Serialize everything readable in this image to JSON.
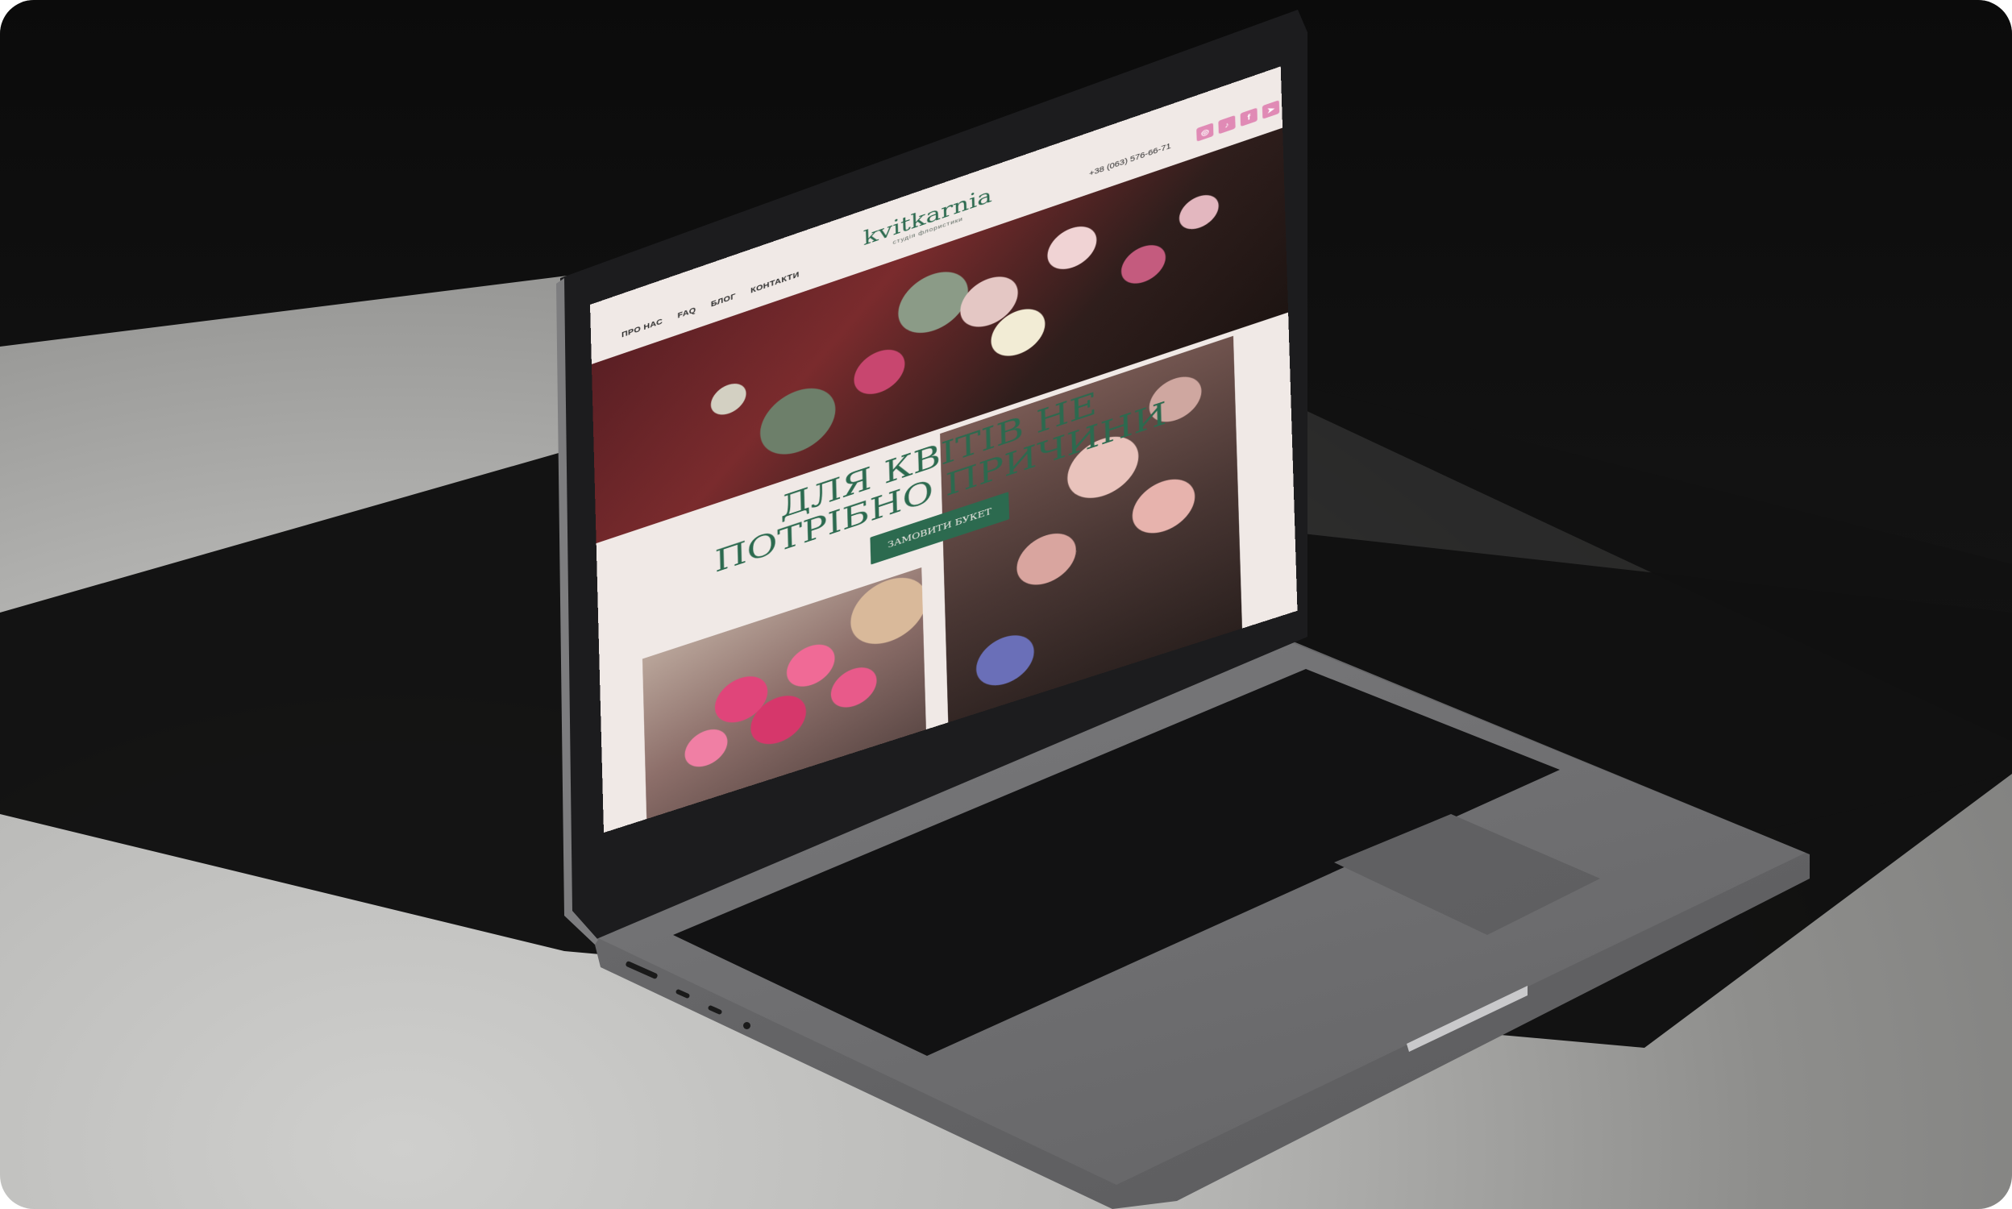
{
  "site": {
    "nav": [
      "ПРО НАС",
      "FAQ",
      "БЛОГ",
      "КОНТАКТИ"
    ],
    "brand_name": "kvitkarnia",
    "brand_sub": "студія флористики",
    "phone": "+38 (063) 576-66-71",
    "socials": [
      {
        "icon": "instagram-icon",
        "glyph": "◎"
      },
      {
        "icon": "tiktok-icon",
        "glyph": "♪"
      },
      {
        "icon": "facebook-icon",
        "glyph": "f"
      },
      {
        "icon": "telegram-icon",
        "glyph": "➤"
      }
    ],
    "hero_line_1": "ДЛЯ КВІТІВ НЕ",
    "hero_line_2": "ПОТРІБНО ПРИЧИНИ",
    "cta_label": "ЗАМОВИТИ БУКЕТ"
  },
  "colors": {
    "brand_green": "#2c6a4f",
    "page_bg": "#f0e9e6",
    "social_pink": "#e08ab5"
  }
}
